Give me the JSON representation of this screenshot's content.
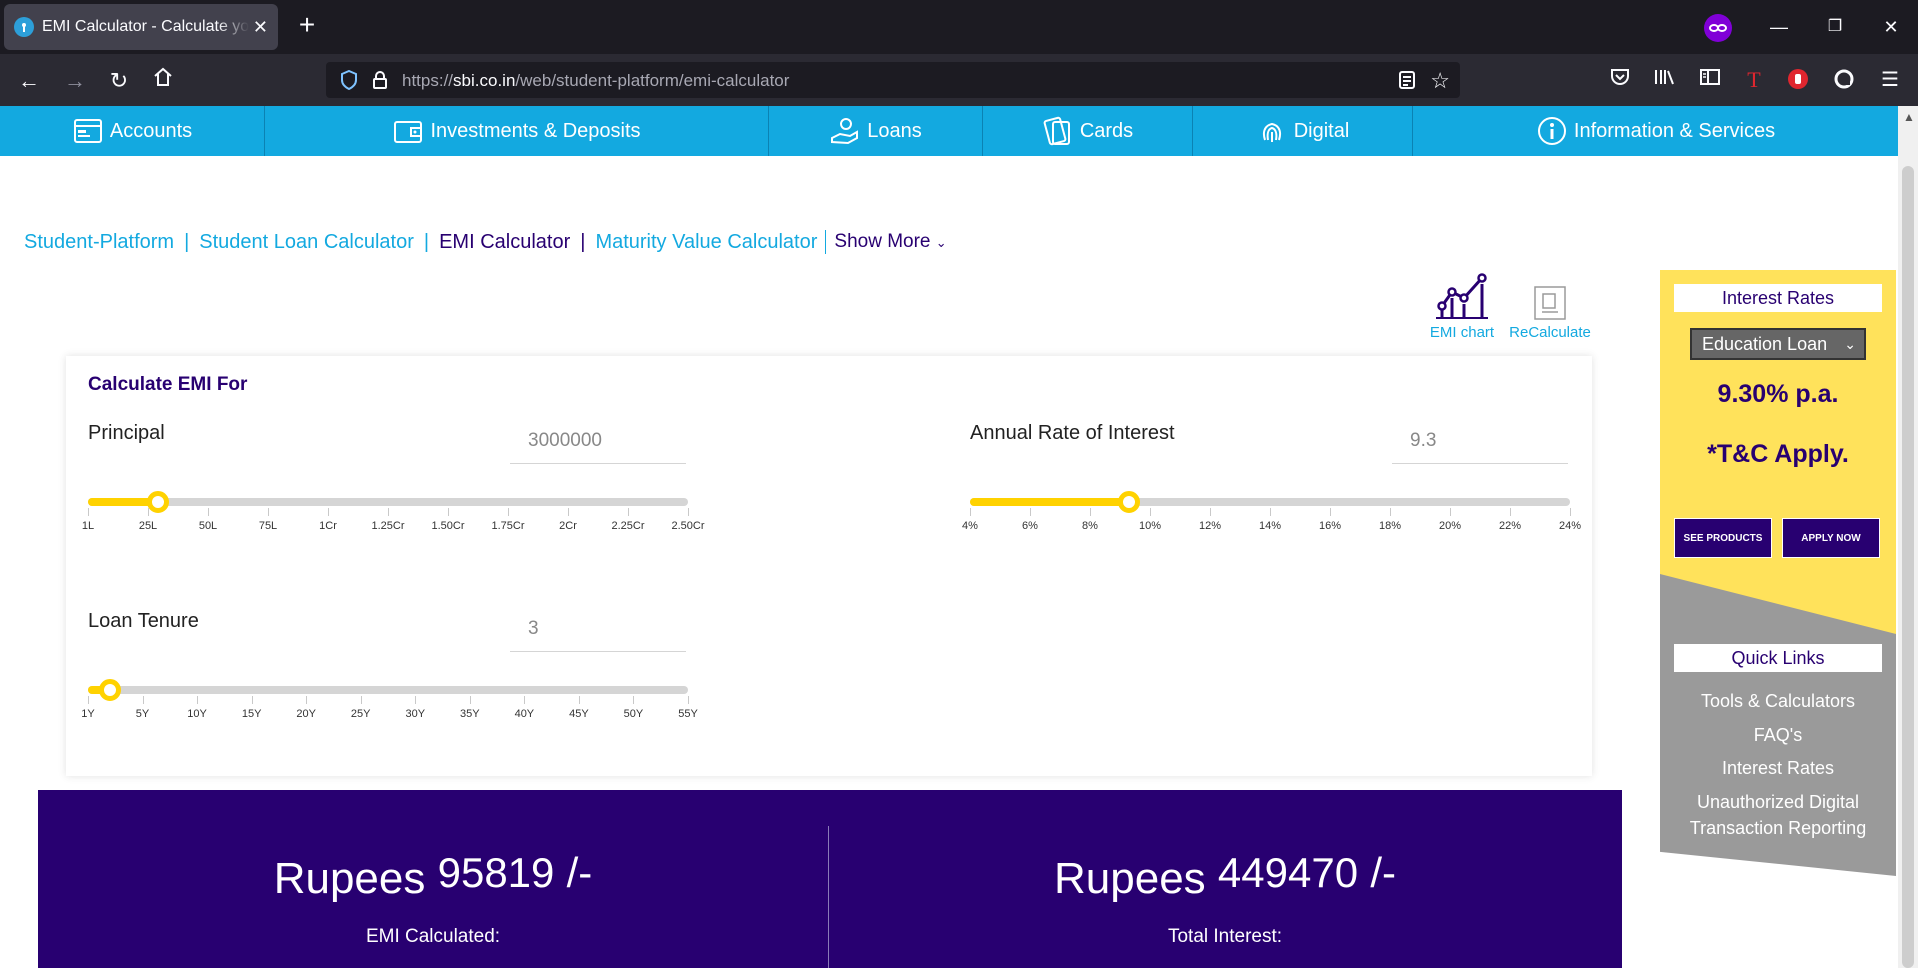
{
  "browser": {
    "tab_title": "EMI Calculator - Calculate your EMI",
    "new_tab": "+",
    "url_prefix": "https://",
    "url_host": "sbi.co.in",
    "url_path": "/web/student-platform/emi-calculator",
    "icons": [
      "back-icon",
      "forward-icon",
      "reload-icon",
      "home-icon",
      "shield-icon",
      "lock-icon",
      "reader-view-icon",
      "bookmark-star-icon",
      "pocket-icon",
      "library-icon",
      "sidebar-icon",
      "extension-t-icon",
      "extension-hand-icon",
      "extension-sync-icon",
      "menu-icon",
      "private-browsing-icon",
      "minimize-icon",
      "restore-icon",
      "close-icon"
    ]
  },
  "site_nav": [
    {
      "label": "Accounts",
      "icon": "accounts-icon"
    },
    {
      "label": "Investments & Deposits",
      "icon": "wallet-icon"
    },
    {
      "label": "Loans",
      "icon": "loans-hand-icon"
    },
    {
      "label": "Cards",
      "icon": "cards-icon"
    },
    {
      "label": "Digital",
      "icon": "fingerprint-icon"
    },
    {
      "label": "Information & Services",
      "icon": "info-icon"
    }
  ],
  "breadcrumb": {
    "items": [
      "Student-Platform",
      "Student Loan Calculator",
      "EMI Calculator",
      "Maturity Value Calculator"
    ],
    "separator": "|",
    "more": "Show More"
  },
  "tools": {
    "chart_label": "EMI chart",
    "recalc_label": "ReCalculate"
  },
  "calculator": {
    "title": "Calculate EMI For",
    "principal": {
      "label": "Principal",
      "value": "3000000",
      "ticks": [
        "1L",
        "25L",
        "50L",
        "75L",
        "1Cr",
        "1.25Cr",
        "1.50Cr",
        "1.75Cr",
        "2Cr",
        "2.25Cr",
        "2.50Cr"
      ],
      "fraction": 0.116
    },
    "rate": {
      "label": "Annual Rate of Interest",
      "value": "9.3",
      "ticks": [
        "4%",
        "6%",
        "8%",
        "10%",
        "12%",
        "14%",
        "16%",
        "18%",
        "20%",
        "22%",
        "24%"
      ],
      "fraction": 0.265
    },
    "tenure": {
      "label": "Loan Tenure",
      "value": "3",
      "ticks": [
        "1Y",
        "5Y",
        "10Y",
        "15Y",
        "20Y",
        "25Y",
        "30Y",
        "35Y",
        "40Y",
        "45Y",
        "50Y",
        "55Y"
      ],
      "fraction": 0.037
    }
  },
  "results": {
    "emi": {
      "prefix": "Rupees",
      "amount": "95819",
      "suffix": "/-",
      "caption": "EMI Calculated:"
    },
    "interest": {
      "prefix": "Rupees",
      "amount": "449470",
      "suffix": "/-",
      "caption": "Total Interest:"
    }
  },
  "side_panel": {
    "interest_header": "Interest Rates",
    "loan_type": "Education Loan",
    "rate": "9.30% p.a.",
    "tc": "*T&C Apply.",
    "see_products": "SEE PRODUCTS",
    "apply_now": "APPLY NOW",
    "quick_links_header": "Quick Links",
    "quick_links": [
      "Tools & Calculators",
      "FAQ's",
      "Interest Rates",
      "Unauthorized Digital",
      "Transaction Reporting"
    ]
  },
  "colors": {
    "sbi_blue": "#13a9e0",
    "sbi_purple": "#280071",
    "slider_yellow": "#ffd200",
    "panel_yellow": "#ffe25b",
    "panel_grey": "#9a9a9a"
  }
}
